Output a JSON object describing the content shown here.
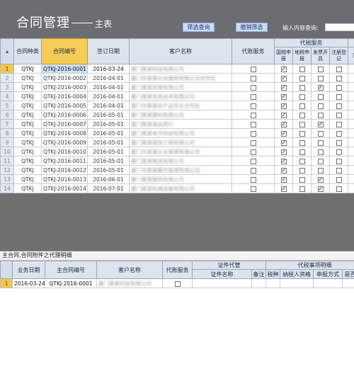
{
  "header": {
    "title": "合同管理",
    "subtitle": "主表",
    "filter_button": "筛选查询",
    "cancel_filter_button": "撤销筛选",
    "search_label": "输入内容查询:",
    "search_value": ""
  },
  "master": {
    "columns": {
      "type": "合同种类",
      "code": "合同编号",
      "date": "签订日期",
      "customer": "客户名称",
      "agency": "代账服务",
      "tax_group": "代税服务",
      "national_tax": "国税申报",
      "local_tax": "地税申报",
      "invoice": "发票开具",
      "register": "注册登记",
      "more_group": "工",
      "more": "变更"
    },
    "rows": [
      {
        "n": "1",
        "type": "QTKJ",
        "code": "QTKJ-2016-0001",
        "date": "2016-03-24",
        "customer": "厦门某某科技有限公司",
        "nt": "✓",
        "lt": "",
        "iv": "",
        "rg": "",
        "mo": ""
      },
      {
        "n": "2",
        "type": "QTKJ",
        "code": "QTKJ-2016-0002",
        "date": "2016-04-01",
        "customer": "厦门市某某企业服务有限公司合作社",
        "nt": "✓",
        "lt": "",
        "iv": "",
        "rg": "",
        "mo": ""
      },
      {
        "n": "3",
        "type": "QTKJ",
        "code": "QTKJ-2016-0003",
        "date": "2016-04-01",
        "customer": "厦门某某贸易有限公司",
        "nt": "✓",
        "lt": "",
        "iv": "✓",
        "rg": "",
        "mo": ""
      },
      {
        "n": "4",
        "type": "QTKJ",
        "code": "QTKJ-2016-0004",
        "date": "2016-04-01",
        "customer": "厦门某某信息技术有限公司",
        "nt": "✓",
        "lt": "",
        "iv": "",
        "rg": "",
        "mo": ""
      },
      {
        "n": "5",
        "type": "QTKJ",
        "code": "QTKJ-2016-0005",
        "date": "2016-04-01",
        "customer": "厦门市某某农产品专业合作社",
        "nt": "✓",
        "lt": "",
        "iv": "",
        "rg": "",
        "mo": ""
      },
      {
        "n": "6",
        "type": "QTKJ",
        "code": "QTKJ-2016-0006",
        "date": "2016-05-01",
        "customer": "厦门某某建材有限公司",
        "nt": "✓",
        "lt": "",
        "iv": "",
        "rg": "",
        "mo": ""
      },
      {
        "n": "7",
        "type": "QTKJ",
        "code": "QTKJ-2016-0007",
        "date": "2016-05-01",
        "customer": "厦门某某食品商行",
        "nt": "✓",
        "lt": "",
        "iv": "✓",
        "rg": "",
        "mo": ""
      },
      {
        "n": "8",
        "type": "QTKJ",
        "code": "QTKJ-2016-0008",
        "date": "2016-05-01",
        "customer": "厦门某某电子科技有限公司",
        "nt": "✓",
        "lt": "",
        "iv": "",
        "rg": "",
        "mo": ""
      },
      {
        "n": "9",
        "type": "QTKJ",
        "code": "QTKJ-2016-0009",
        "date": "2016-05-01",
        "customer": "厦门某某装饰工程有限公司",
        "nt": "✓",
        "lt": "",
        "iv": "",
        "rg": "",
        "mo": ""
      },
      {
        "n": "10",
        "type": "QTKJ",
        "code": "QTKJ-2016-0010",
        "date": "2016-05-01",
        "customer": "厦门市某某企业管理有限公司",
        "nt": "✓",
        "lt": "",
        "iv": "",
        "rg": "",
        "mo": ""
      },
      {
        "n": "11",
        "type": "QTKJ",
        "code": "QTKJ-2016-0011",
        "date": "2016-05-01",
        "customer": "厦门某某物流有限公司",
        "nt": "✓",
        "lt": "",
        "iv": "",
        "rg": "",
        "mo": ""
      },
      {
        "n": "12",
        "type": "QTKJ",
        "code": "QTKJ-2016-0012",
        "date": "2016-05-01",
        "customer": "厦门市某某餐饮管理有限公司",
        "nt": "✓",
        "lt": "",
        "iv": "",
        "rg": "",
        "mo": ""
      },
      {
        "n": "13",
        "type": "QTKJ",
        "code": "QTKJ-2016-0013",
        "date": "2016-06-01",
        "customer": "厦门某某服饰有限公司",
        "nt": "✓",
        "lt": "",
        "iv": "✓",
        "rg": "",
        "mo": ""
      },
      {
        "n": "14",
        "type": "QTKJ",
        "code": "QTKJ-2016-0014",
        "date": "2016-07-01",
        "customer": "厦门某某机械设备有限公司",
        "nt": "✓",
        "lt": "",
        "iv": "✓",
        "rg": "",
        "mo": ""
      }
    ]
  },
  "detail": {
    "caption": "主合同.合同附件之代理明细",
    "columns": {
      "business_date": "业务日期",
      "master_code": "主合同编号",
      "customer": "客户名称",
      "agency": "代账服务",
      "cert_group": "证件代管",
      "cert_name": "证件名称",
      "remark": "备注",
      "tax_group": "代税事项明细",
      "tax_kind": "税种",
      "taxpayer_qual": "纳税人资格",
      "filing_method": "申报方式",
      "zero_filing": "是否零"
    },
    "rows": [
      {
        "n": "1",
        "date": "2016-03-24",
        "code": "QTKJ-2016-0001",
        "customer": "厦门某某科技有限公司"
      }
    ]
  }
}
